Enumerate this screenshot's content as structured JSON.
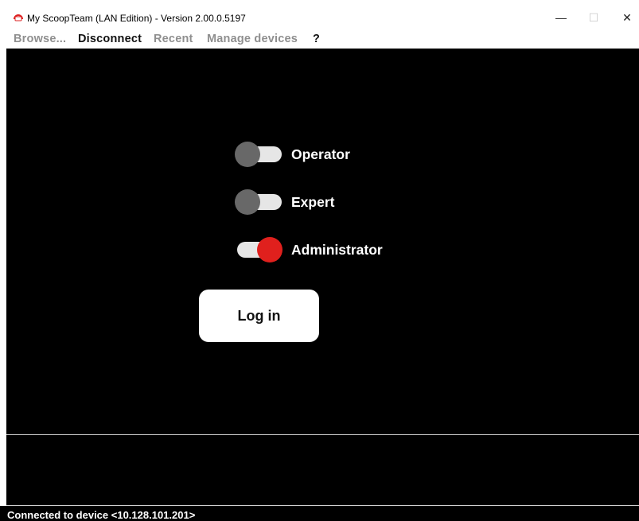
{
  "window": {
    "title": "My ScoopTeam (LAN Edition) - Version 2.00.0.5197",
    "controls": {
      "minimize": "—",
      "maximize": "☐",
      "close": "✕"
    }
  },
  "menu": {
    "browse": "Browse...",
    "disconnect": "Disconnect",
    "recent": "Recent",
    "manage_devices": "Manage devices",
    "help": "?"
  },
  "roles": [
    {
      "label": "Operator",
      "selected": false
    },
    {
      "label": "Expert",
      "selected": false
    },
    {
      "label": "Administrator",
      "selected": true
    }
  ],
  "login_button": "Log in",
  "status": "Connected to device <10.128.101.201>",
  "colors": {
    "accent": "#e0201d",
    "knob_off": "#686868",
    "track": "#e6e6e6",
    "background": "#000000"
  }
}
